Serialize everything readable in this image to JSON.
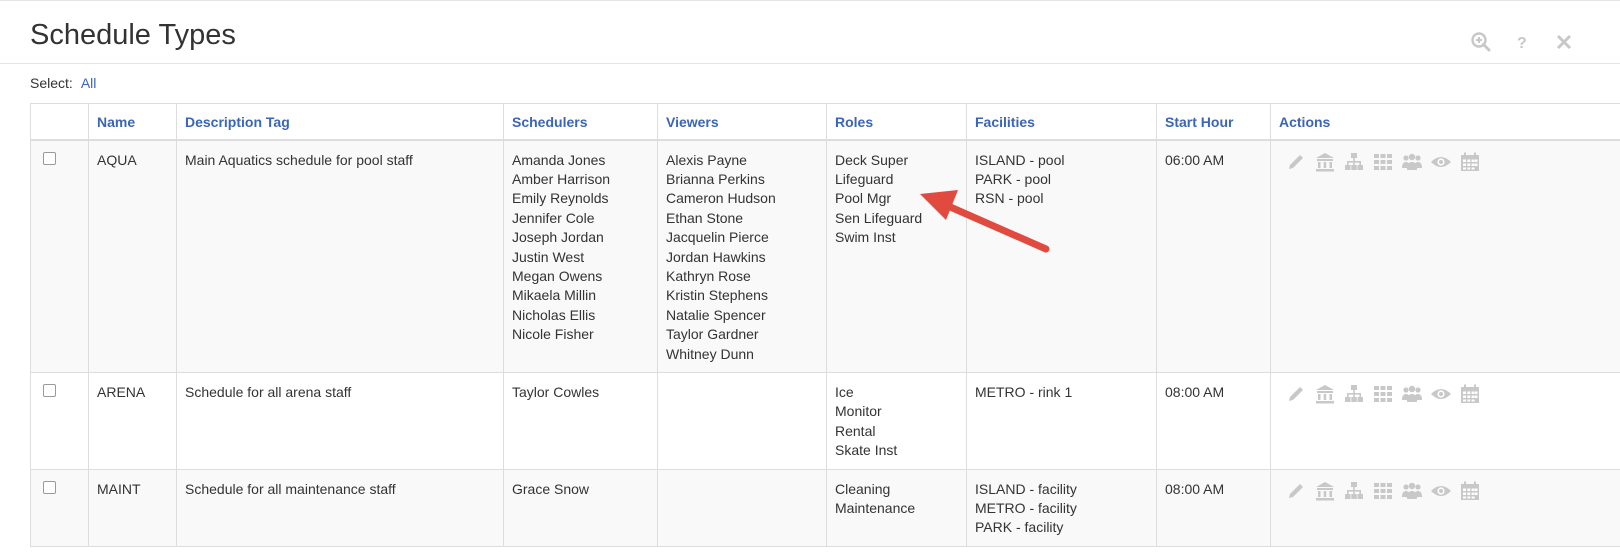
{
  "page": {
    "title": "Schedule Types",
    "select_label": "Select:",
    "select_all": "All"
  },
  "header_icons": [
    "zoom-in-icon",
    "help-icon",
    "close-icon"
  ],
  "table": {
    "columns": [
      "Name",
      "Description Tag",
      "Schedulers",
      "Viewers",
      "Roles",
      "Facilities",
      "Start Hour",
      "Actions"
    ],
    "rows": [
      {
        "name": "AQUA",
        "description": "Main Aquatics schedule for pool staff",
        "schedulers": [
          "Amanda Jones",
          "Amber Harrison",
          "Emily Reynolds",
          "Jennifer Cole",
          "Joseph Jordan",
          "Justin West",
          "Megan Owens",
          "Mikaela Millin",
          "Nicholas Ellis",
          "Nicole Fisher"
        ],
        "viewers": [
          "Alexis Payne",
          "Brianna Perkins",
          "Cameron Hudson",
          "Ethan Stone",
          "Jacquelin Pierce",
          "Jordan Hawkins",
          "Kathryn Rose",
          "Kristin Stephens",
          "Natalie Spencer",
          "Taylor Gardner",
          "Whitney Dunn"
        ],
        "roles": [
          "Deck Super",
          "Lifeguard",
          "Pool Mgr",
          "Sen Lifeguard",
          "Swim Inst"
        ],
        "facilities": [
          "ISLAND - pool",
          "PARK - pool",
          "RSN - pool"
        ],
        "start_hour": "06:00 AM"
      },
      {
        "name": "ARENA",
        "description": "Schedule for all arena staff",
        "schedulers": [
          "Taylor Cowles"
        ],
        "viewers": [],
        "roles": [
          "Ice",
          "Monitor",
          "Rental",
          "Skate Inst"
        ],
        "facilities": [
          "METRO - rink 1"
        ],
        "start_hour": "08:00 AM"
      },
      {
        "name": "MAINT",
        "description": "Schedule for all maintenance staff",
        "schedulers": [
          "Grace Snow"
        ],
        "viewers": [],
        "roles": [
          "Cleaning",
          "Maintenance"
        ],
        "facilities": [
          "ISLAND - facility",
          "METRO - facility",
          "PARK - facility"
        ],
        "start_hour": "08:00 AM"
      }
    ],
    "action_icons": [
      "edit-icon",
      "facility-icon",
      "hierarchy-icon",
      "grid-icon",
      "users-icon",
      "view-icon",
      "calendar-icon"
    ]
  },
  "colors": {
    "link": "#3a65b8",
    "action_icon": "#c8c8c8",
    "annotation_arrow": "#e04a3f"
  }
}
